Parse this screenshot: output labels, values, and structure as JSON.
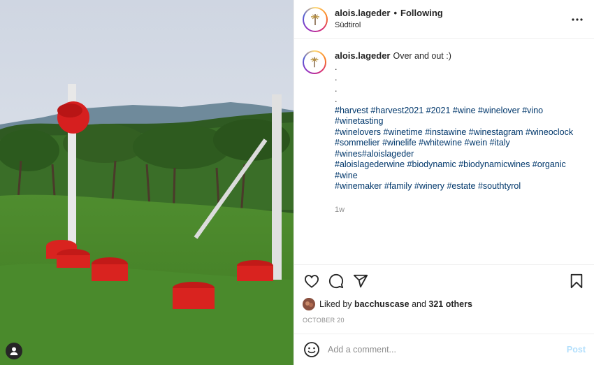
{
  "post": {
    "author": "alois.lageder",
    "follow_state": "Following",
    "separator": "•",
    "location": "Südtirol",
    "caption_text": "Over and out :)",
    "caption_dots": [
      ".",
      ".",
      ".",
      "."
    ],
    "hashtag_lines": [
      "#harvest #harvest2021 #2021 #wine #winelover #vino #winetasting",
      "#winelovers #winetime #instawine #winestagram #wineoclock",
      "#sommelier #winelife #whitewine #wein #italy #wines#aloislageder",
      "#aloislagederwine #biodynamic #biodynamicwines #organic #wine",
      "#winemaker #family #winery #estate #southtyrol"
    ],
    "time_ago": "1w",
    "likes_prefix": "Liked by",
    "liked_by_user": "bacchuscase",
    "likes_and": "and",
    "likes_others": "321 others",
    "date": "OCTOBER 20"
  },
  "comment_box": {
    "placeholder": "Add a comment...",
    "post_label": "Post"
  },
  "icons": {
    "more": "more-horizontal-icon",
    "like": "heart-icon",
    "comment": "comment-bubble-icon",
    "share": "paper-plane-icon",
    "save": "bookmark-icon",
    "emoji": "smiley-icon",
    "user_tag": "person-icon"
  },
  "colors": {
    "hashtag": "#00376b",
    "muted": "#8e8e8e",
    "post_disabled": "#b2dffc"
  }
}
